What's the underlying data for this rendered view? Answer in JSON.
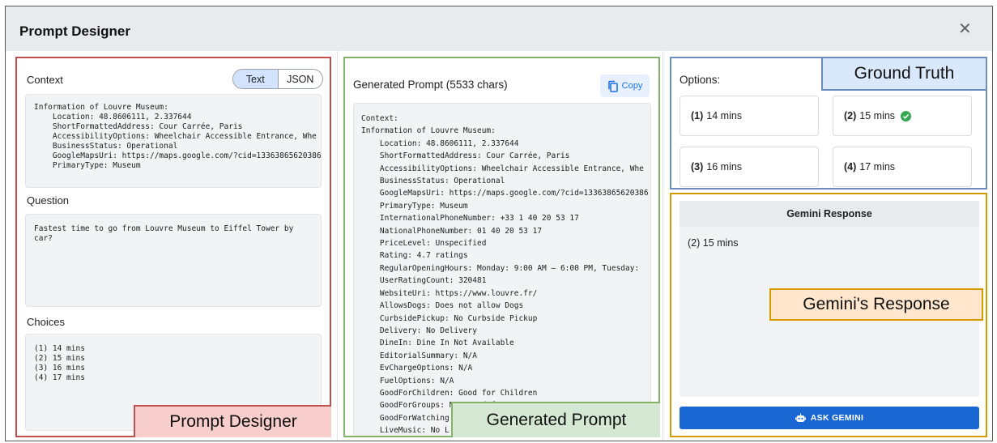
{
  "window": {
    "title": "Prompt Designer",
    "close_icon": "close-icon"
  },
  "designer": {
    "context_label": "Context",
    "toggle": {
      "text": "Text",
      "json": "JSON",
      "selected": "Text"
    },
    "context_text": "Information of Louvre Museum:\n    Location: 48.8606111, 2.337644\n    ShortFormattedAddress: Cour Carrée, Paris\n    AccessibilityOptions: Wheelchair Accessible Entrance, Whe\n    BusinessStatus: Operational\n    GoogleMapsUri: https://maps.google.com/?cid=13363865620386\n    PrimaryType: Museum",
    "question_label": "Question",
    "question_text": "Fastest time to go from Louvre Museum to Eiffel Tower by car?",
    "choices_label": "Choices",
    "choices_text": "(1) 14 mins\n(2) 15 mins\n(3) 16 mins\n(4) 17 mins"
  },
  "generated": {
    "title": "Generated Prompt (5533 chars)",
    "copy_label": "Copy",
    "prompt_text": "Context:\nInformation of Louvre Museum:\n    Location: 48.8606111, 2.337644\n    ShortFormattedAddress: Cour Carrée, Paris\n    AccessibilityOptions: Wheelchair Accessible Entrance, Whe\n    BusinessStatus: Operational\n    GoogleMapsUri: https://maps.google.com/?cid=13363865620386\n    PrimaryType: Museum\n    InternationalPhoneNumber: +33 1 40 20 53 17\n    NationalPhoneNumber: 01 40 20 53 17\n    PriceLevel: Unspecified\n    Rating: 4.7 ratings\n    RegularOpeningHours: Monday: 9:00 AM – 6:00 PM, Tuesday:\n    UserRatingCount: 320481\n    WebsiteUri: https://www.louvre.fr/\n    AllowsDogs: Does not allow Dogs\n    CurbsidePickup: No Curbside Pickup\n    Delivery: No Delivery\n    DineIn: Dine In Not Available\n    EditorialSummary: N/A\n    EvChargeOptions: N/A\n    FuelOptions: N/A\n    GoodForChildren: Good for Children\n    GoodForGroups: Not good for Groups\n    GoodForWatching\n    LiveMusic: No L"
  },
  "options": {
    "title": "Options:",
    "items": [
      {
        "num": "(1)",
        "label": "14 mins",
        "correct": false
      },
      {
        "num": "(2)",
        "label": "15 mins",
        "correct": true
      },
      {
        "num": "(3)",
        "label": "16 mins",
        "correct": false
      },
      {
        "num": "(4)",
        "label": "17 mins",
        "correct": false
      }
    ]
  },
  "gemini": {
    "header": "Gemini Response",
    "response": "(2) 15 mins",
    "ask_button": "ASK GEMINI"
  },
  "annotations": {
    "prompt_designer": "Prompt Designer",
    "generated_prompt": "Generated Prompt",
    "ground_truth": "Ground Truth",
    "gemini_response": "Gemini's Response"
  },
  "colors": {
    "designer_border": "#c0504d",
    "generated_border": "#82b366",
    "ground_truth_border": "#6c8ebf",
    "gemini_border": "#d79b00",
    "accent": "#1967d2",
    "success": "#34a853"
  }
}
